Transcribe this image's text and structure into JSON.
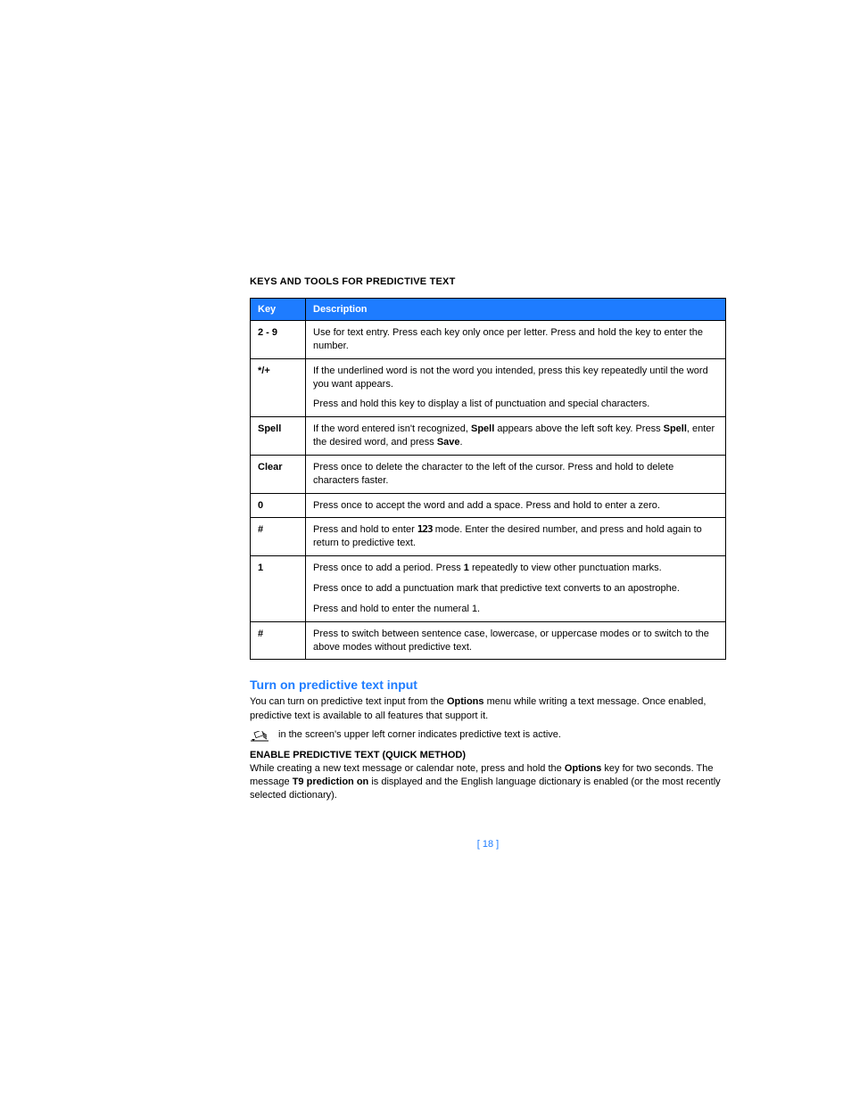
{
  "heading": "KEYS AND TOOLS FOR PREDICTIVE TEXT",
  "table": {
    "headers": {
      "key": "Key",
      "desc": "Description"
    },
    "rows": [
      {
        "key": "2 - 9",
        "parts": [
          {
            "text": "Use for text entry. Press each key only once per letter. Press and hold the key to enter the number."
          }
        ]
      },
      {
        "key": "*/+",
        "parts": [
          {
            "text": "If the underlined word is not the word you intended, press this key repeatedly until the word you want appears."
          },
          {
            "text": "Press and hold this key to display a list of punctuation and special characters."
          }
        ]
      },
      {
        "key": "Spell",
        "parts": [
          {
            "pre": "If the word entered isn't recognized, ",
            "b1": "Spell",
            "mid": " appears above the left soft key. Press ",
            "b2": "Spell",
            "mid2": ", enter the desired word, and press ",
            "b3": "Save",
            "post": "."
          }
        ]
      },
      {
        "key": "Clear",
        "parts": [
          {
            "text": "Press once to delete the character to the left of the cursor. Press and hold to delete characters faster."
          }
        ]
      },
      {
        "key": "0",
        "parts": [
          {
            "text": "Press once to accept the word and add a space. Press and hold to enter a zero."
          }
        ]
      },
      {
        "key": "#",
        "parts": [
          {
            "pre": "Press and hold to enter ",
            "icon": "123",
            "post": " mode. Enter the desired number, and press and hold again to return to predictive text."
          }
        ]
      },
      {
        "key": "1",
        "parts": [
          {
            "pre": "Press once to add a period. Press ",
            "b1": "1",
            "post": " repeatedly to view other punctuation marks."
          },
          {
            "text": "Press once to add a punctuation mark that predictive text converts to an apostrophe."
          },
          {
            "text": "Press and hold to enter the numeral 1."
          }
        ]
      },
      {
        "key": "#",
        "parts": [
          {
            "text": "Press to switch between sentence case, lowercase, or uppercase modes or to switch to the above modes without predictive text."
          }
        ]
      }
    ]
  },
  "turnon": {
    "title": "Turn on predictive text input",
    "p1_pre": "You can turn on predictive text input from the ",
    "p1_b": "Options",
    "p1_post": " menu while writing a text message. Once enabled, predictive text is available to all features that support it.",
    "p2": "in the screen's upper left corner indicates predictive text is active."
  },
  "enable": {
    "heading": "ENABLE PREDICTIVE TEXT (QUICK METHOD)",
    "p_pre": "While creating a new text message or calendar note, press and hold the ",
    "p_b1": "Options",
    "p_mid": " key for two seconds. The message ",
    "p_b2": "T9 prediction on",
    "p_post": " is displayed and the English language dictionary is enabled (or the most recently selected dictionary)."
  },
  "page_number": "[ 18 ]"
}
